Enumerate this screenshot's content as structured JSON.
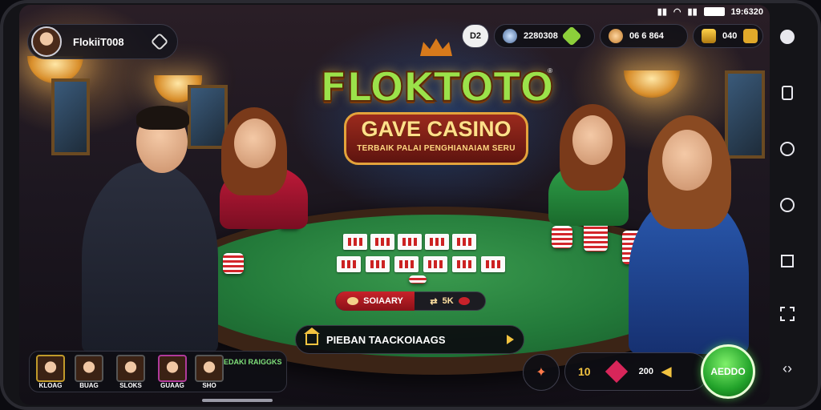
{
  "status_bar": {
    "time": "19:6320"
  },
  "profile": {
    "username": "FlokiiT008"
  },
  "top_stats": {
    "level": "D2",
    "coins": "2280308",
    "hearts": "06 6 864",
    "gold": "040"
  },
  "logo": {
    "title": "FLOKTOTO",
    "subtitle": "GAVE CASINO",
    "tagline": "TERBAIK PALAI PENGHIANAIAM SERU",
    "registered": "®"
  },
  "bet": {
    "left_label": "SOIAARY",
    "right_label": "5K"
  },
  "action": {
    "label": "PIEBAN TAACKOIAAGS"
  },
  "players": [
    {
      "name": "KLOAG"
    },
    {
      "name": "BUAG"
    },
    {
      "name": "SLOKS"
    },
    {
      "name": "GUAAG"
    },
    {
      "name": "SHO"
    }
  ],
  "players_status": "EDAKI RAIGGKS",
  "wallet": {
    "left": "10",
    "amount": "200"
  },
  "go_button": "AEDDO",
  "icons": {
    "profile_link": "link-icon",
    "coins": "coin-icon",
    "hearts": "face-icon",
    "gold": "treasure-icon",
    "home": "home-icon",
    "play": "play-icon"
  },
  "colors": {
    "go": "#22a22a",
    "felt": "#237a3a",
    "accent": "#f2c340"
  }
}
